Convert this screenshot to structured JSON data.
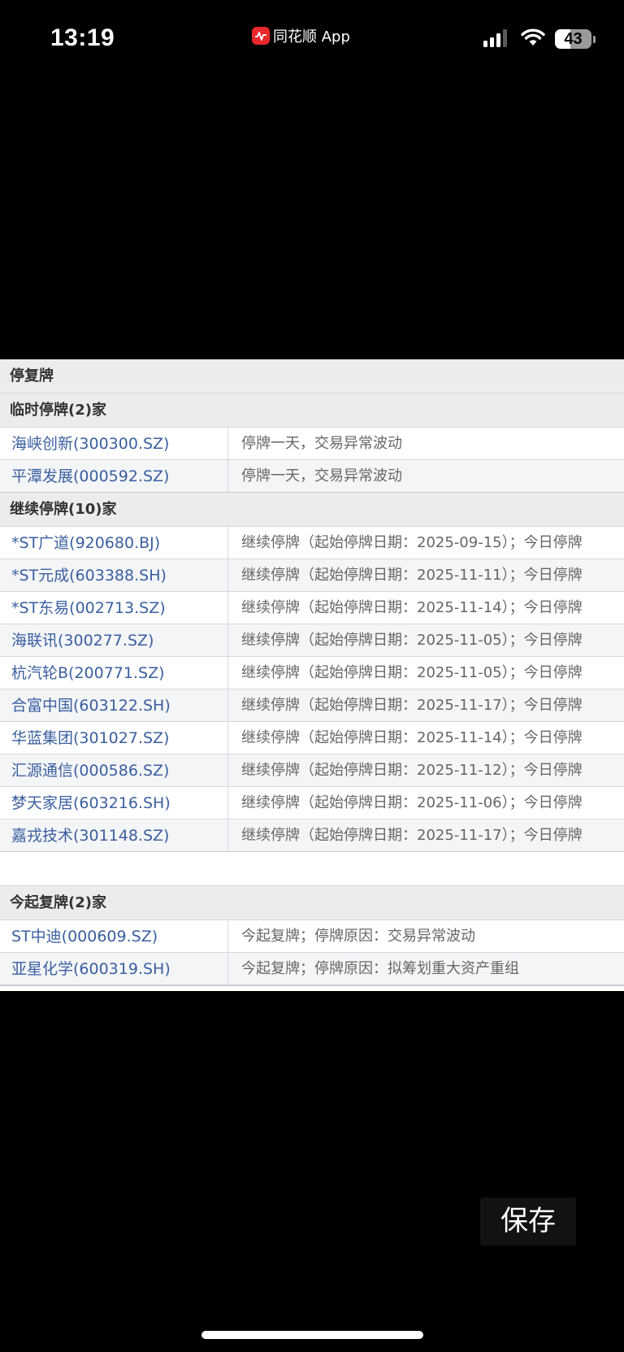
{
  "status_bar": {
    "time": "13:19",
    "app_name": "同花顺 App",
    "battery": "43",
    "battery_level_percent": 43
  },
  "table": {
    "title": "停复牌",
    "sections": [
      {
        "header": "临时停牌(2)家",
        "rows": [
          {
            "name": "海峡创新(300300.SZ)",
            "desc": "停牌一天，交易异常波动"
          },
          {
            "name": "平潭发展(000592.SZ)",
            "desc": "停牌一天，交易异常波动"
          }
        ]
      },
      {
        "header": "继续停牌(10)家",
        "rows": [
          {
            "name": "*ST广道(920680.BJ)",
            "desc": "继续停牌（起始停牌日期：2025-09-15）；今日停牌"
          },
          {
            "name": "*ST元成(603388.SH)",
            "desc": "继续停牌（起始停牌日期：2025-11-11）；今日停牌"
          },
          {
            "name": "*ST东易(002713.SZ)",
            "desc": "继续停牌（起始停牌日期：2025-11-14）；今日停牌"
          },
          {
            "name": "海联讯(300277.SZ)",
            "desc": "继续停牌（起始停牌日期：2025-11-05）；今日停牌"
          },
          {
            "name": "杭汽轮B(200771.SZ)",
            "desc": "继续停牌（起始停牌日期：2025-11-05）；今日停牌"
          },
          {
            "name": "合富中国(603122.SH)",
            "desc": "继续停牌（起始停牌日期：2025-11-17）；今日停牌"
          },
          {
            "name": "华蓝集团(301027.SZ)",
            "desc": "继续停牌（起始停牌日期：2025-11-14）；今日停牌"
          },
          {
            "name": "汇源通信(000586.SZ)",
            "desc": "继续停牌（起始停牌日期：2025-11-12）；今日停牌"
          },
          {
            "name": "梦天家居(603216.SH)",
            "desc": "继续停牌（起始停牌日期：2025-11-06）；今日停牌"
          },
          {
            "name": "嘉戎技术(301148.SZ)",
            "desc": "继续停牌（起始停牌日期：2025-11-17）；今日停牌"
          }
        ]
      },
      {
        "header": "今起复牌(2)家",
        "rows": [
          {
            "name": "ST中迪(000609.SZ)",
            "desc": "今起复牌；停牌原因：交易异常波动"
          },
          {
            "name": "亚星化学(600319.SH)",
            "desc": "今起复牌；停牌原因：拟筹划重大资产重组"
          }
        ]
      }
    ]
  },
  "save_button": {
    "label": "保存"
  }
}
